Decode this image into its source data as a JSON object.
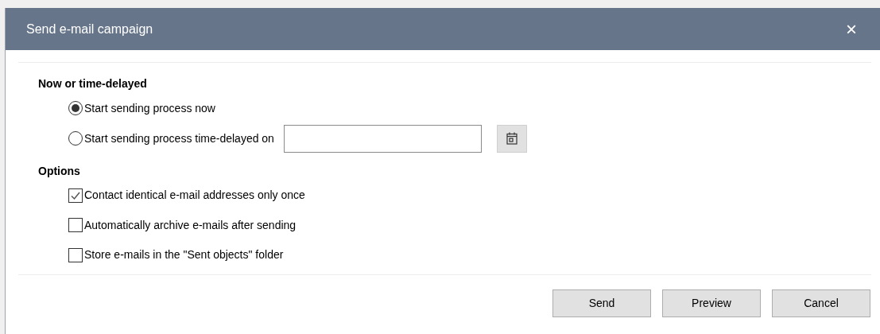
{
  "window": {
    "title": "Send e-mail campaign",
    "close": "×"
  },
  "sections": [
    {
      "heading": "Now or time-delayed",
      "items": [
        {
          "kind": "radio",
          "label": "Start sending process now",
          "selected": true
        },
        {
          "kind": "radio",
          "label": "Start sending process time-delayed on",
          "selected": false,
          "date_field": true
        }
      ]
    },
    {
      "heading": "Options",
      "items": [
        {
          "kind": "checkbox",
          "label": "Contact identical e-mail addresses only once",
          "checked": true
        },
        {
          "kind": "checkbox",
          "label": "Automatically archive e-mails after sending",
          "checked": false
        },
        {
          "kind": "checkbox",
          "label": "Store e-mails in the \"Sent objects\" folder",
          "checked": false
        }
      ]
    }
  ],
  "buttons": [
    "Send",
    "Preview",
    "Cancel"
  ]
}
